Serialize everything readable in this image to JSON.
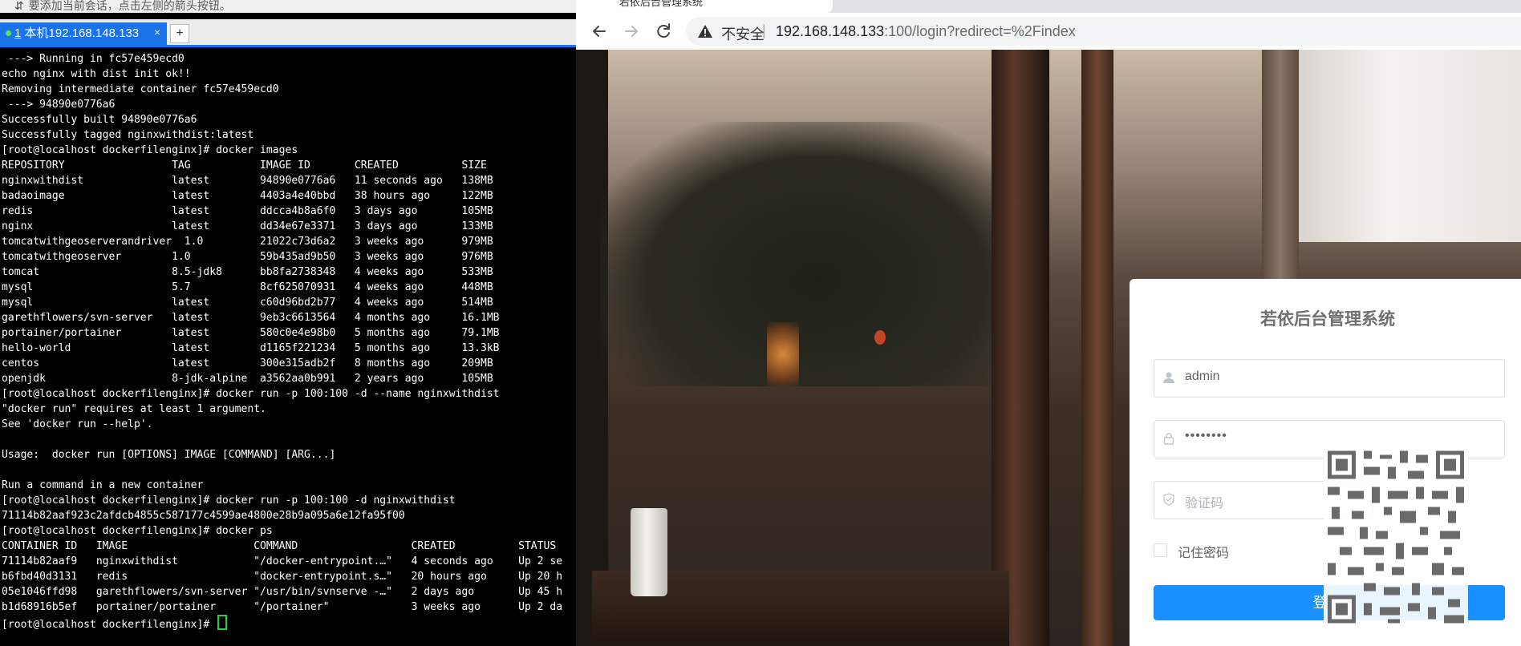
{
  "terminal_client": {
    "hint_text": "要添加当前会话，点击左侧的箭头按钮。",
    "tab": {
      "index": "1",
      "label": "本机192.168.148.133",
      "close": "×"
    },
    "add_tab": "+"
  },
  "terminal": {
    "lines": [
      " ---> Running in fc57e459ecd0",
      "echo nginx with dist init ok!!",
      "Removing intermediate container fc57e459ecd0",
      " ---> 94890e0776a6",
      "Successfully built 94890e0776a6",
      "Successfully tagged nginxwithdist:latest",
      "[root@localhost dockerfilenginx]# docker images",
      "REPOSITORY                 TAG           IMAGE ID       CREATED          SIZE",
      "nginxwithdist              latest        94890e0776a6   11 seconds ago   138MB",
      "badaoimage                 latest        4403a4e40bbd   38 hours ago     122MB",
      "redis                      latest        ddcca4b8a6f0   3 days ago       105MB",
      "nginx                      latest        dd34e67e3371   3 days ago       133MB",
      "tomcatwithgeoserverandriver  1.0         21022c73d6a2   3 weeks ago      979MB",
      "tomcatwithgeoserver        1.0           59b435ad9b50   3 weeks ago      976MB",
      "tomcat                     8.5-jdk8      bb8fa2738348   4 weeks ago      533MB",
      "mysql                      5.7           8cf625070931   4 weeks ago      448MB",
      "mysql                      latest        c60d96bd2b77   4 weeks ago      514MB",
      "garethflowers/svn-server   latest        9eb3c6613564   4 months ago     16.1MB",
      "portainer/portainer        latest        580c0e4e98b0   5 months ago     79.1MB",
      "hello-world                latest        d1165f221234   5 months ago     13.3kB",
      "centos                     latest        300e315adb2f   8 months ago     209MB",
      "openjdk                    8-jdk-alpine  a3562aa0b991   2 years ago      105MB",
      "[root@localhost dockerfilenginx]# docker run -p 100:100 -d --name nginxwithdist",
      "\"docker run\" requires at least 1 argument.",
      "See 'docker run --help'.",
      "",
      "Usage:  docker run [OPTIONS] IMAGE [COMMAND] [ARG...]",
      "",
      "Run a command in a new container",
      "[root@localhost dockerfilenginx]# docker run -p 100:100 -d nginxwithdist",
      "71114b82aaf923c2afdcb4855c587177c4599ae4800e28b9a095a6e12fa95f00",
      "[root@localhost dockerfilenginx]# docker ps",
      "CONTAINER ID   IMAGE                    COMMAND                  CREATED          STATUS",
      "71114b82aaf9   nginxwithdist            \"/docker-entrypoint.…\"   4 seconds ago    Up 2 se",
      "b6fbd40d3131   redis                    \"docker-entrypoint.s…\"   20 hours ago     Up 20 h",
      "05e1046ffd98   garethflowers/svn-server \"/usr/bin/svnserve -…\"   2 days ago       Up 45 h",
      "b1d68916b5ef   portainer/portainer      \"/portainer\"             3 weeks ago      Up 2 da"
    ],
    "prompt": "[root@localhost dockerfilenginx]# "
  },
  "browser": {
    "tab_title": "若依后台管理系统",
    "address": {
      "not_secure": "不安全",
      "separator": "|",
      "host": "192.168.148.133",
      "path": ":100/login?redirect=%2Findex"
    }
  },
  "login": {
    "title": "若依后台管理系统",
    "username_value": "admin",
    "password_value": "••••••••",
    "captcha_placeholder": "验证码",
    "remember_label": "记住密码",
    "submit_label": "登 录"
  },
  "colors": {
    "terminal_bg": "#000000",
    "terminal_fg": "#ffffff",
    "tab_accent": "#1a73e8",
    "login_button": "#1890ff"
  }
}
